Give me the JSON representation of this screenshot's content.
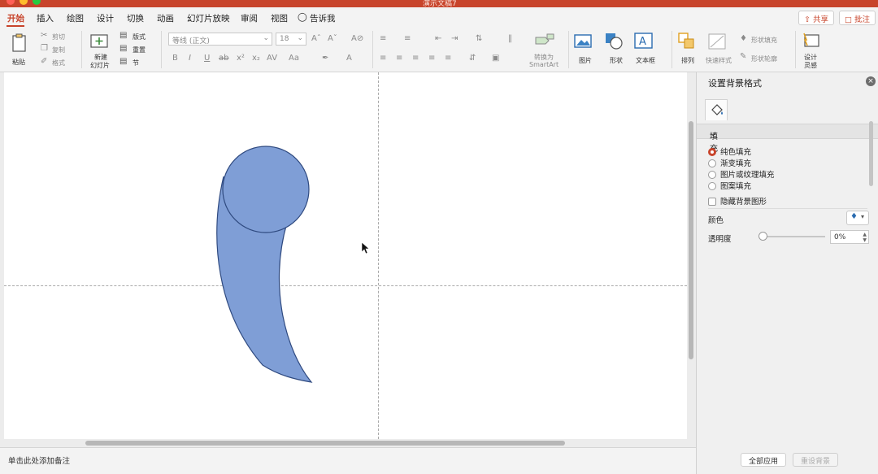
{
  "window": {
    "doc_title": "演示文稿7",
    "colors": {
      "accent": "#c8442b",
      "shape_fill": "#7f9ed6",
      "shape_stroke": "#2f4a80"
    }
  },
  "tabs": [
    {
      "label": "开始",
      "active": true
    },
    {
      "label": "插入"
    },
    {
      "label": "绘图"
    },
    {
      "label": "设计"
    },
    {
      "label": "切换"
    },
    {
      "label": "动画"
    },
    {
      "label": "幻灯片放映"
    },
    {
      "label": "审阅"
    },
    {
      "label": "视图"
    },
    {
      "label": "告诉我"
    }
  ],
  "top_buttons": {
    "share": "共享",
    "comment": "批注"
  },
  "ribbon": {
    "paste": "粘贴",
    "cut": "剪切",
    "copy": "复制",
    "format": "格式",
    "new_slide_line1": "新建",
    "new_slide_line2": "幻灯片",
    "layout": "版式",
    "reset": "重置",
    "section": "节",
    "font_name": "等线 (正文)",
    "font_size": "18",
    "smartart_line1": "转换为",
    "smartart_line2": "SmartArt",
    "picture": "图片",
    "shapes": "形状",
    "textbox": "文本框",
    "arrange": "排列",
    "quick_styles": "快速样式",
    "shape_fill": "形状填充",
    "shape_outline": "形状轮廓",
    "designer_line1": "设计",
    "designer_line2": "灵感"
  },
  "notes": {
    "placeholder": "单击此处添加备注"
  },
  "panel": {
    "title": "设置背景格式",
    "section": "填充",
    "fill_options": [
      {
        "label": "纯色填充",
        "selected": true
      },
      {
        "label": "渐变填充",
        "selected": false
      },
      {
        "label": "图片或纹理填充",
        "selected": false
      },
      {
        "label": "图案填充",
        "selected": false
      }
    ],
    "hide_background_graphics": "隐藏背景图形",
    "color_label": "颜色",
    "transparency_label": "透明度",
    "transparency_value": "0%",
    "transparency": 0,
    "apply_all": "全部应用",
    "reset_background": "重设背景"
  }
}
